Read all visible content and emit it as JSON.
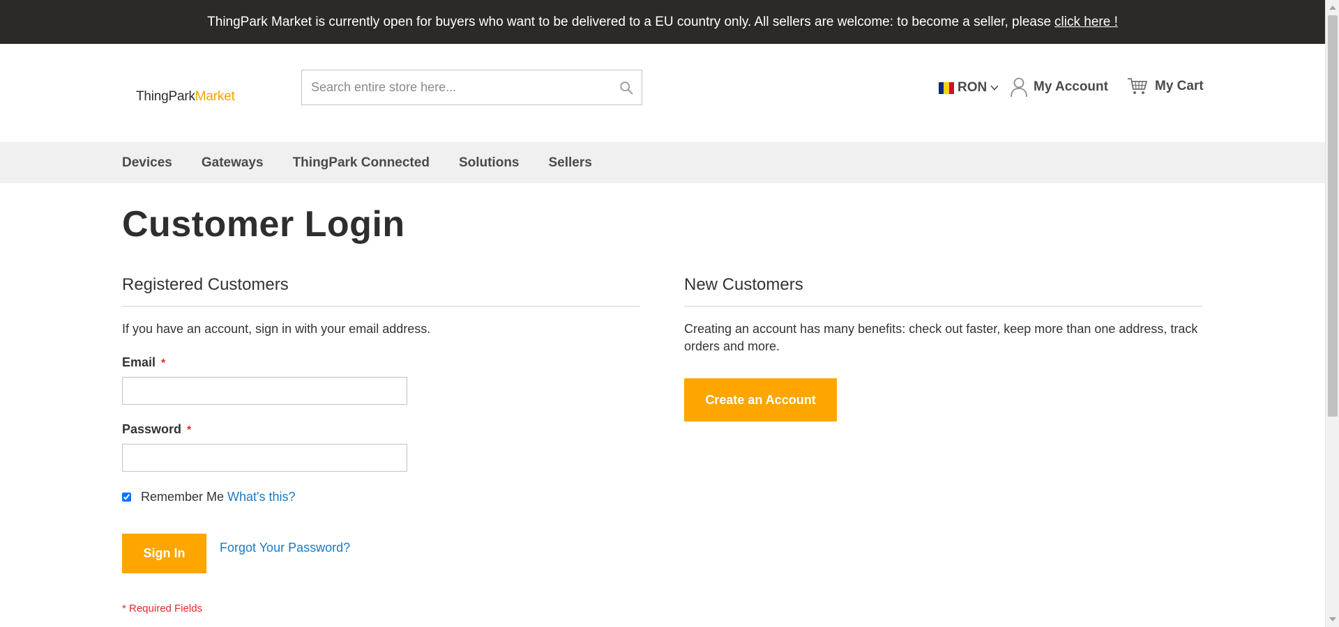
{
  "notice": {
    "text": "ThingPark Market is currently open for buyers who want to be delivered to a EU country only. All sellers are welcome: to become a seller, please",
    "link": "click here !"
  },
  "header": {
    "logo_part1": "ThingPark",
    "logo_part2": "Market",
    "search_placeholder": "Search entire store here...",
    "currency": "RON",
    "account_label": "My Account",
    "cart_label": "My Cart"
  },
  "nav": {
    "items": [
      "Devices",
      "Gateways",
      "ThingPark Connected",
      "Solutions",
      "Sellers"
    ]
  },
  "page": {
    "title": "Customer Login"
  },
  "registered": {
    "title": "Registered Customers",
    "intro": "If you have an account, sign in with your email address.",
    "email_label": "Email",
    "password_label": "Password",
    "required_mark": "*",
    "remember_label": "Remember Me",
    "whats_this": "What's this?",
    "remember_checked": true,
    "signin_label": "Sign In",
    "forgot_label": "Forgot Your Password?",
    "required_note": "* Required Fields"
  },
  "new_customers": {
    "title": "New Customers",
    "text": "Creating an account has many benefits: check out faster, keep more than one address, track orders and more.",
    "create_label": "Create an Account"
  },
  "colors": {
    "topbar": "#2b2a28",
    "accent": "#ffa500",
    "link": "#1979c3",
    "required": "#e02b27",
    "flag": [
      "#002b7f",
      "#fcd116",
      "#ce1126"
    ]
  }
}
